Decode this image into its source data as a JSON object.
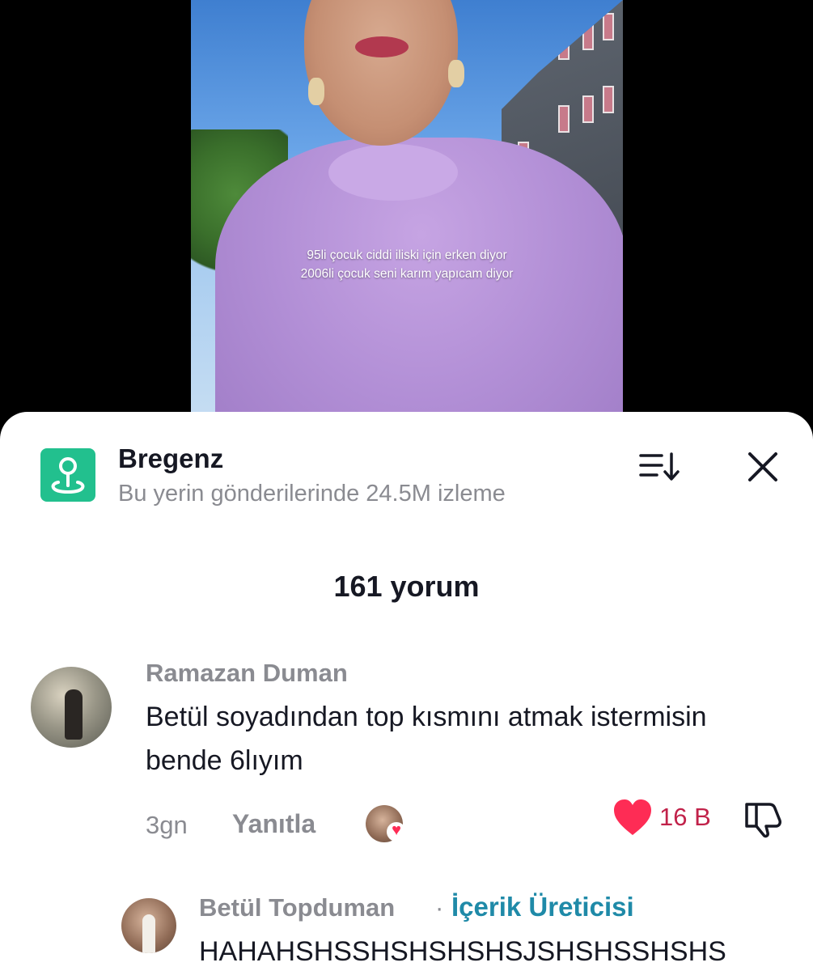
{
  "video": {
    "caption_line1": "95li çocuk ciddi iliski için erken diyor",
    "caption_line2": "2006li çocuk seni karım yapıcam diyor"
  },
  "place": {
    "icon": "map-pin-icon",
    "title": "Bregenz",
    "subtitle": "Bu yerin gönderilerinde 24.5M izleme"
  },
  "header": {
    "sort_icon": "sort-icon",
    "close_icon": "close-icon"
  },
  "comments_count": "161 yorum",
  "comments": [
    {
      "author": "Ramazan Duman",
      "text": "Betül soyadından top kısmını atmak istermisin bende 6lıyım",
      "time": "3gn",
      "reply_label": "Yanıtla",
      "likes": "16 B",
      "liked_by_creator": true
    },
    {
      "author": "Betül Topduman",
      "separator": "·",
      "badge": "İçerik Üreticisi",
      "text": "HAHAHSHSSHSHSHSHSJSHSHSSHSHS"
    }
  ],
  "colors": {
    "accent_pink": "#fe2c55",
    "place_green": "#22c08e",
    "creator_badge": "#1f8aa8",
    "muted_text": "#8a8b91"
  }
}
